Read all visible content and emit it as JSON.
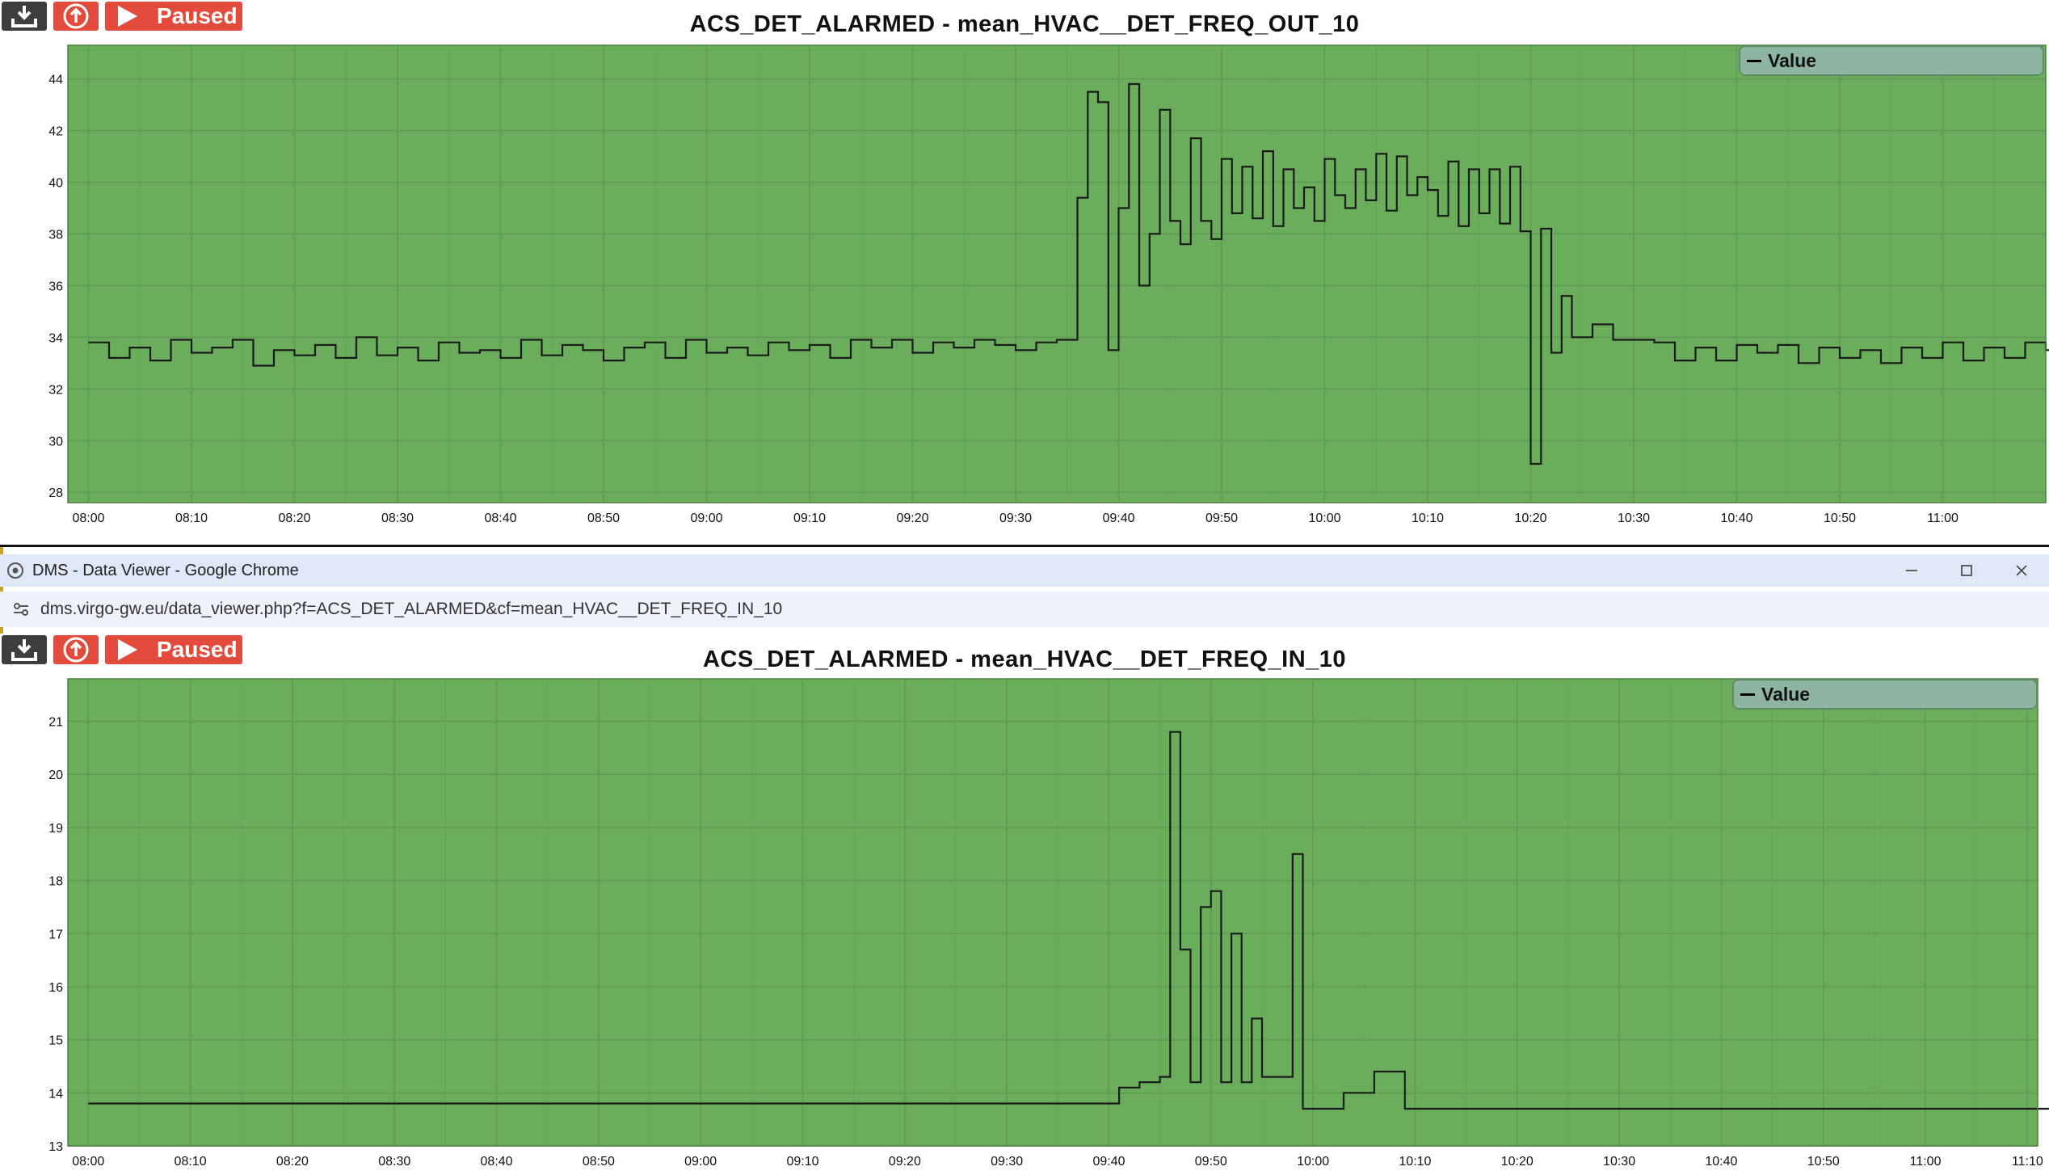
{
  "toolbar": {
    "paused_label": "Paused"
  },
  "browser": {
    "window_title": "DMS - Data Viewer - Google Chrome",
    "url": "dms.virgo-gw.eu/data_viewer.php?f=ACS_DET_ALARMED&cf=mean_HVAC__DET_FREQ_IN_10"
  },
  "colors": {
    "plot_bg": "#6aae5c",
    "line": "#1a1a1a",
    "button_red": "#e34b3c",
    "button_dark": "#3e3e3e"
  },
  "chart_data": [
    {
      "type": "line",
      "title": "ACS_DET_ALARMED - mean_HVAC__DET_FREQ_OUT_10",
      "series": [
        {
          "name": "Value",
          "x": [
            0,
            2,
            4,
            6,
            8,
            10,
            12,
            14,
            16,
            18,
            20,
            22,
            24,
            26,
            28,
            30,
            32,
            34,
            36,
            38,
            40,
            42,
            44,
            46,
            48,
            50,
            52,
            54,
            56,
            58,
            60,
            62,
            64,
            66,
            68,
            70,
            72,
            74,
            76,
            78,
            80,
            82,
            84,
            86,
            88,
            90,
            92,
            94,
            96,
            97,
            98,
            99,
            100,
            101,
            102,
            103,
            104,
            105,
            106,
            107,
            108,
            109,
            110,
            111,
            112,
            113,
            114,
            115,
            116,
            117,
            118,
            119,
            120,
            121,
            122,
            123,
            124,
            125,
            126,
            127,
            128,
            129,
            130,
            131,
            132,
            133,
            134,
            135,
            136,
            137,
            138,
            139,
            140,
            141,
            142,
            143,
            144,
            146,
            148,
            150,
            152,
            154,
            156,
            158,
            160,
            162,
            164,
            166,
            168,
            170,
            172,
            174,
            176,
            178,
            180,
            182,
            184,
            186,
            188,
            190,
            191
          ],
          "y": [
            33.8,
            33.2,
            33.6,
            33.1,
            33.9,
            33.4,
            33.6,
            33.9,
            32.9,
            33.5,
            33.3,
            33.7,
            33.2,
            34.0,
            33.3,
            33.6,
            33.1,
            33.8,
            33.4,
            33.5,
            33.2,
            33.9,
            33.3,
            33.7,
            33.5,
            33.1,
            33.6,
            33.8,
            33.2,
            33.9,
            33.4,
            33.6,
            33.3,
            33.8,
            33.5,
            33.7,
            33.2,
            33.9,
            33.6,
            33.9,
            33.4,
            33.8,
            33.6,
            33.9,
            33.7,
            33.5,
            33.8,
            33.9,
            39.4,
            43.5,
            43.1,
            33.5,
            39.0,
            43.8,
            36.0,
            38.0,
            42.8,
            38.5,
            37.6,
            41.7,
            38.5,
            37.8,
            40.9,
            38.8,
            40.6,
            38.6,
            41.2,
            38.3,
            40.5,
            39.0,
            39.8,
            38.5,
            40.9,
            39.5,
            39.0,
            40.5,
            39.3,
            41.1,
            38.9,
            41.0,
            39.5,
            40.2,
            39.7,
            38.7,
            40.8,
            38.3,
            40.5,
            38.8,
            40.5,
            38.4,
            40.6,
            38.1,
            29.1,
            38.2,
            33.4,
            35.6,
            34.0,
            34.5,
            33.9,
            33.9,
            33.8,
            33.1,
            33.6,
            33.1,
            33.7,
            33.4,
            33.7,
            33.0,
            33.6,
            33.2,
            33.5,
            33.0,
            33.6,
            33.2,
            33.8,
            33.1,
            33.6,
            33.2,
            33.8,
            33.5,
            33.1
          ],
          "x_end": 192
        }
      ],
      "x_ticks": [
        "08:00",
        "08:10",
        "08:20",
        "08:30",
        "08:40",
        "08:50",
        "09:00",
        "09:10",
        "09:20",
        "09:30",
        "09:40",
        "09:50",
        "10:00",
        "10:10",
        "10:20",
        "10:30",
        "10:40",
        "10:50",
        "11:00"
      ],
      "y_ticks": [
        28,
        30,
        32,
        34,
        36,
        38,
        40,
        42,
        44
      ],
      "ylim": [
        27.6,
        45.3
      ],
      "xlim": [
        -2,
        190
      ],
      "legend": "top-right",
      "grid": true
    },
    {
      "type": "line",
      "title": "ACS_DET_ALARMED - mean_HVAC__DET_FREQ_IN_10",
      "series": [
        {
          "name": "Value",
          "x": [
            0,
            101,
            103,
            105,
            106,
            107,
            108,
            109,
            110,
            111,
            112,
            113,
            114,
            115,
            116,
            118,
            119,
            123,
            126,
            129
          ],
          "y": [
            13.8,
            14.1,
            14.2,
            14.3,
            20.8,
            16.7,
            14.2,
            17.5,
            17.8,
            14.2,
            17.0,
            14.2,
            15.4,
            14.3,
            14.3,
            18.5,
            13.7,
            14.0,
            14.4,
            13.7
          ],
          "x_end": 193
        }
      ],
      "x_ticks": [
        "08:00",
        "08:10",
        "08:20",
        "08:30",
        "08:40",
        "08:50",
        "09:00",
        "09:10",
        "09:20",
        "09:30",
        "09:40",
        "09:50",
        "10:00",
        "10:10",
        "10:20",
        "10:30",
        "10:40",
        "10:50",
        "11:00",
        "11:10"
      ],
      "y_ticks": [
        13,
        14,
        15,
        16,
        17,
        18,
        19,
        20,
        21
      ],
      "ylim": [
        13.0,
        21.8
      ],
      "xlim": [
        -2,
        191
      ],
      "legend": "top-right",
      "grid": true
    }
  ]
}
